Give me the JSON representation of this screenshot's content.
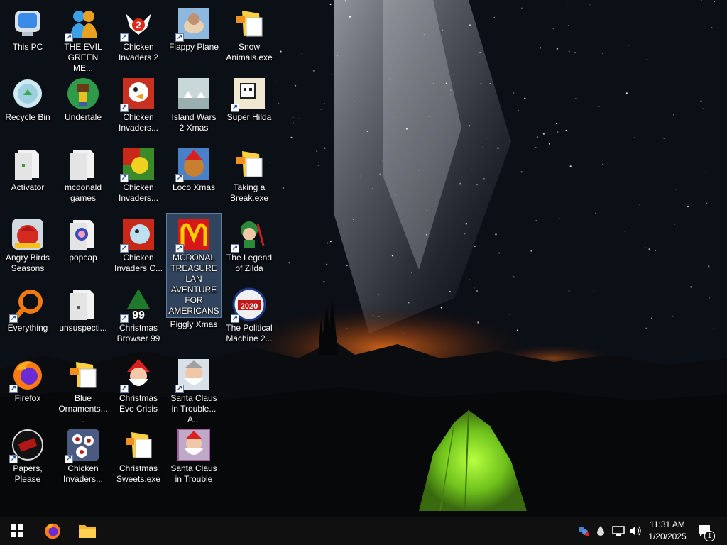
{
  "desktop_icons": [
    {
      "label": "This PC"
    },
    {
      "label": "THE EVIL GREEN ME..."
    },
    {
      "label": "Chicken Invaders 2"
    },
    {
      "label": "Flappy Plane"
    },
    {
      "label": "Snow Animals.exe"
    },
    {
      "label": "Recycle Bin"
    },
    {
      "label": "Undertale"
    },
    {
      "label": "Chicken Invaders..."
    },
    {
      "label": "Island Wars 2 Xmas"
    },
    {
      "label": "Super Hilda"
    },
    {
      "label": "Activator"
    },
    {
      "label": "mcdonald games"
    },
    {
      "label": "Chicken Invaders..."
    },
    {
      "label": "Loco Xmas"
    },
    {
      "label": "Taking a Break.exe"
    },
    {
      "label": "Angry Birds Seasons"
    },
    {
      "label": "popcap"
    },
    {
      "label": "Chicken Invaders C..."
    },
    {
      "label": "MCDONAL TREASURE LAN AVENTURE FOR AMERICANS"
    },
    {
      "label": "The Legend of Zilda"
    },
    {
      "label": "Everything"
    },
    {
      "label": "unsuspecti..."
    },
    {
      "label": "Christmas Browser 99"
    },
    {
      "label": "Piggly Xmas"
    },
    {
      "label": "The Political Machine 2..."
    },
    {
      "label": "Firefox"
    },
    {
      "label": "Blue Ornaments...."
    },
    {
      "label": "Christmas Eve Crisis"
    },
    {
      "label": "Santa Claus in Trouble... A..."
    },
    {
      "label": "Papers, Please"
    },
    {
      "label": "Chicken Invaders..."
    },
    {
      "label": "Christmas Sweets.exe"
    },
    {
      "label": "Santa Claus in Trouble"
    }
  ],
  "taskbar": {
    "time": "11:31 AM",
    "date": "1/20/2025",
    "notification_count": "1"
  },
  "colors": {
    "taskbar": "#101010",
    "tent": "#6fc21c",
    "selection": "#78aae6"
  }
}
